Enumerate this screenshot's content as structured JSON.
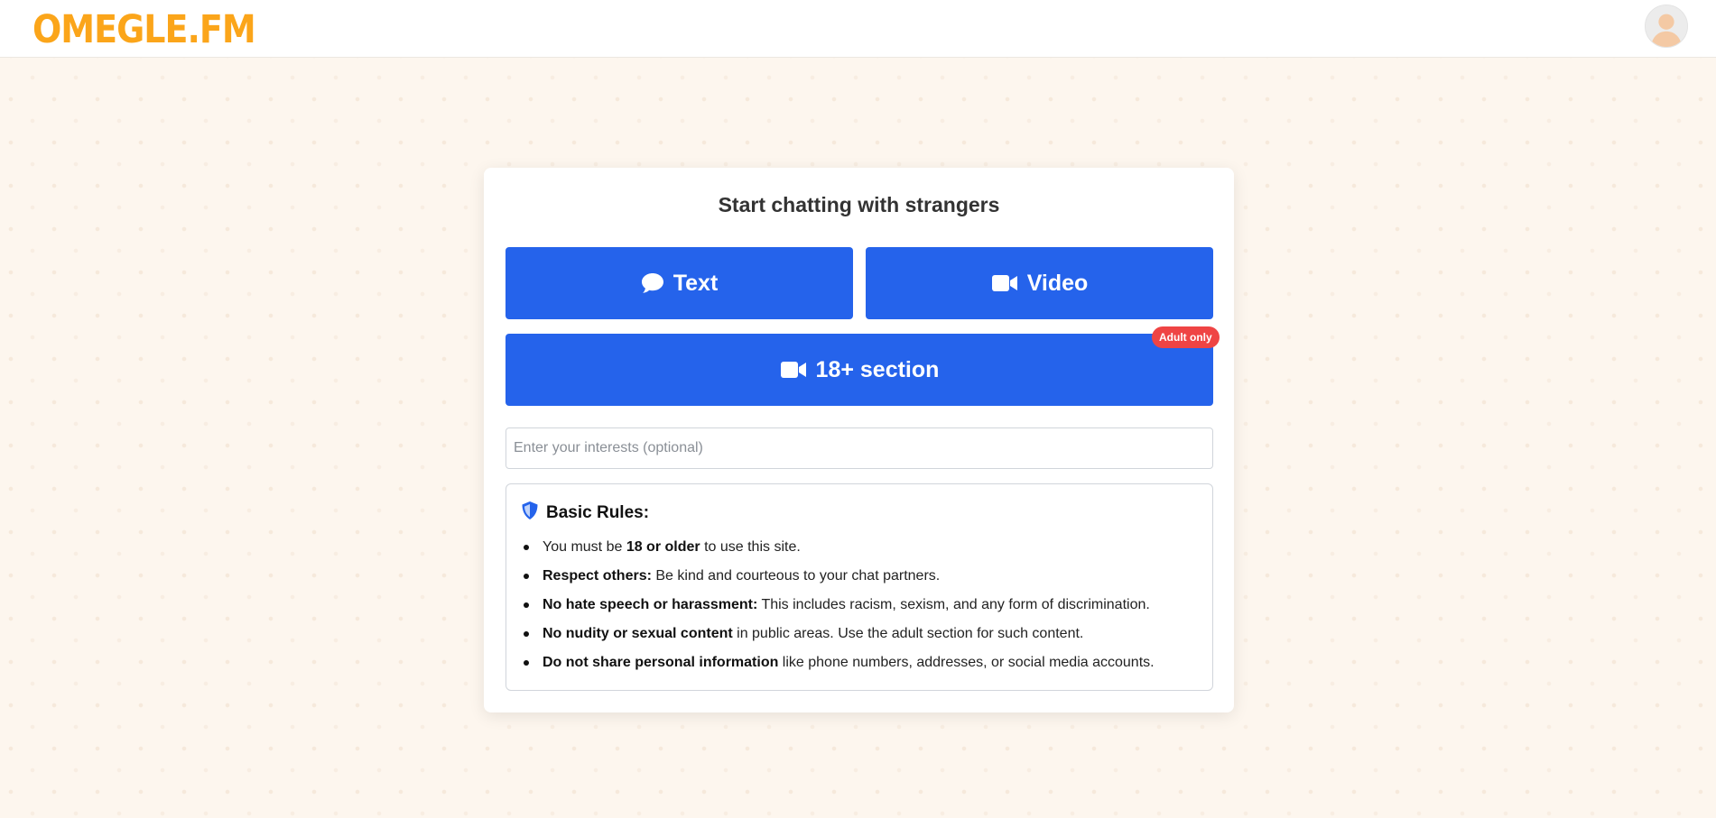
{
  "header": {
    "logo_text": "OMEGLE.FM",
    "logo_color": "#fba51a",
    "avatar_icon": "user-avatar-icon"
  },
  "card": {
    "title": "Start chatting with strangers",
    "buttons": {
      "text_label": "Text",
      "text_icon": "chat-bubble-icon",
      "video_label": "Video",
      "video_icon": "video-camera-icon",
      "adult_label": "18+ section",
      "adult_icon": "video-camera-icon",
      "adult_badge": "Adult only"
    },
    "interests": {
      "value": "",
      "placeholder": "Enter your interests (optional)"
    },
    "rules": {
      "icon": "shield-icon",
      "title": "Basic Rules:",
      "items": [
        {
          "pre": "You must be ",
          "bold": "18 or older",
          "post": " to use this site."
        },
        {
          "pre": "",
          "bold": "Respect others:",
          "post": " Be kind and courteous to your chat partners."
        },
        {
          "pre": "",
          "bold": "No hate speech or harassment:",
          "post": " This includes racism, sexism, and any form of discrimination."
        },
        {
          "pre": "",
          "bold": "No nudity or sexual content",
          "post": " in public areas. Use the adult section for such content."
        },
        {
          "pre": "",
          "bold": "Do not share personal information",
          "post": " like phone numbers, addresses, or social media accounts."
        }
      ]
    }
  },
  "colors": {
    "primary_button": "#2563eb",
    "badge": "#ef4444",
    "background": "#fdf6ee"
  }
}
